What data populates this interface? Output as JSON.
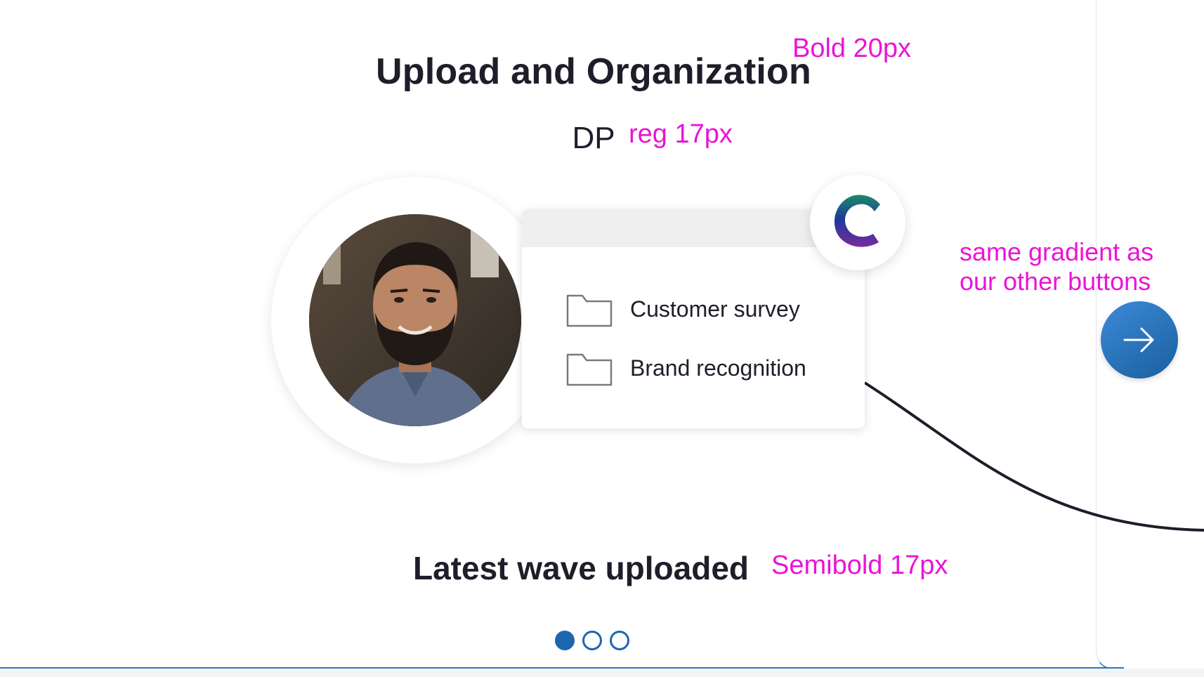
{
  "header": {
    "title": "Upload and Organization",
    "subtitle": "DP"
  },
  "annotations": {
    "title_note": "Bold 20px",
    "subtitle_note": "reg 17px",
    "button_note_line1": "same gradient as",
    "button_note_line2": "our other buttons",
    "caption_note": "Semibold 17px"
  },
  "illustration": {
    "folders": [
      {
        "label": "Customer survey",
        "icon": "folder-icon"
      },
      {
        "label": "Brand recognition",
        "icon": "folder-icon"
      }
    ],
    "avatar_icon": "user-photo",
    "logo_icon": "c-logo-icon"
  },
  "caption": "Latest wave uploaded",
  "next_button": {
    "icon": "arrow-right-icon",
    "gradient": [
      "#3c8ad8",
      "#1a5f9e"
    ]
  },
  "pagination": {
    "total": 3,
    "current": 1
  },
  "colors": {
    "accent": "#1d66b0",
    "annotation": "#ea14d6",
    "text": "#1e1e2a"
  }
}
